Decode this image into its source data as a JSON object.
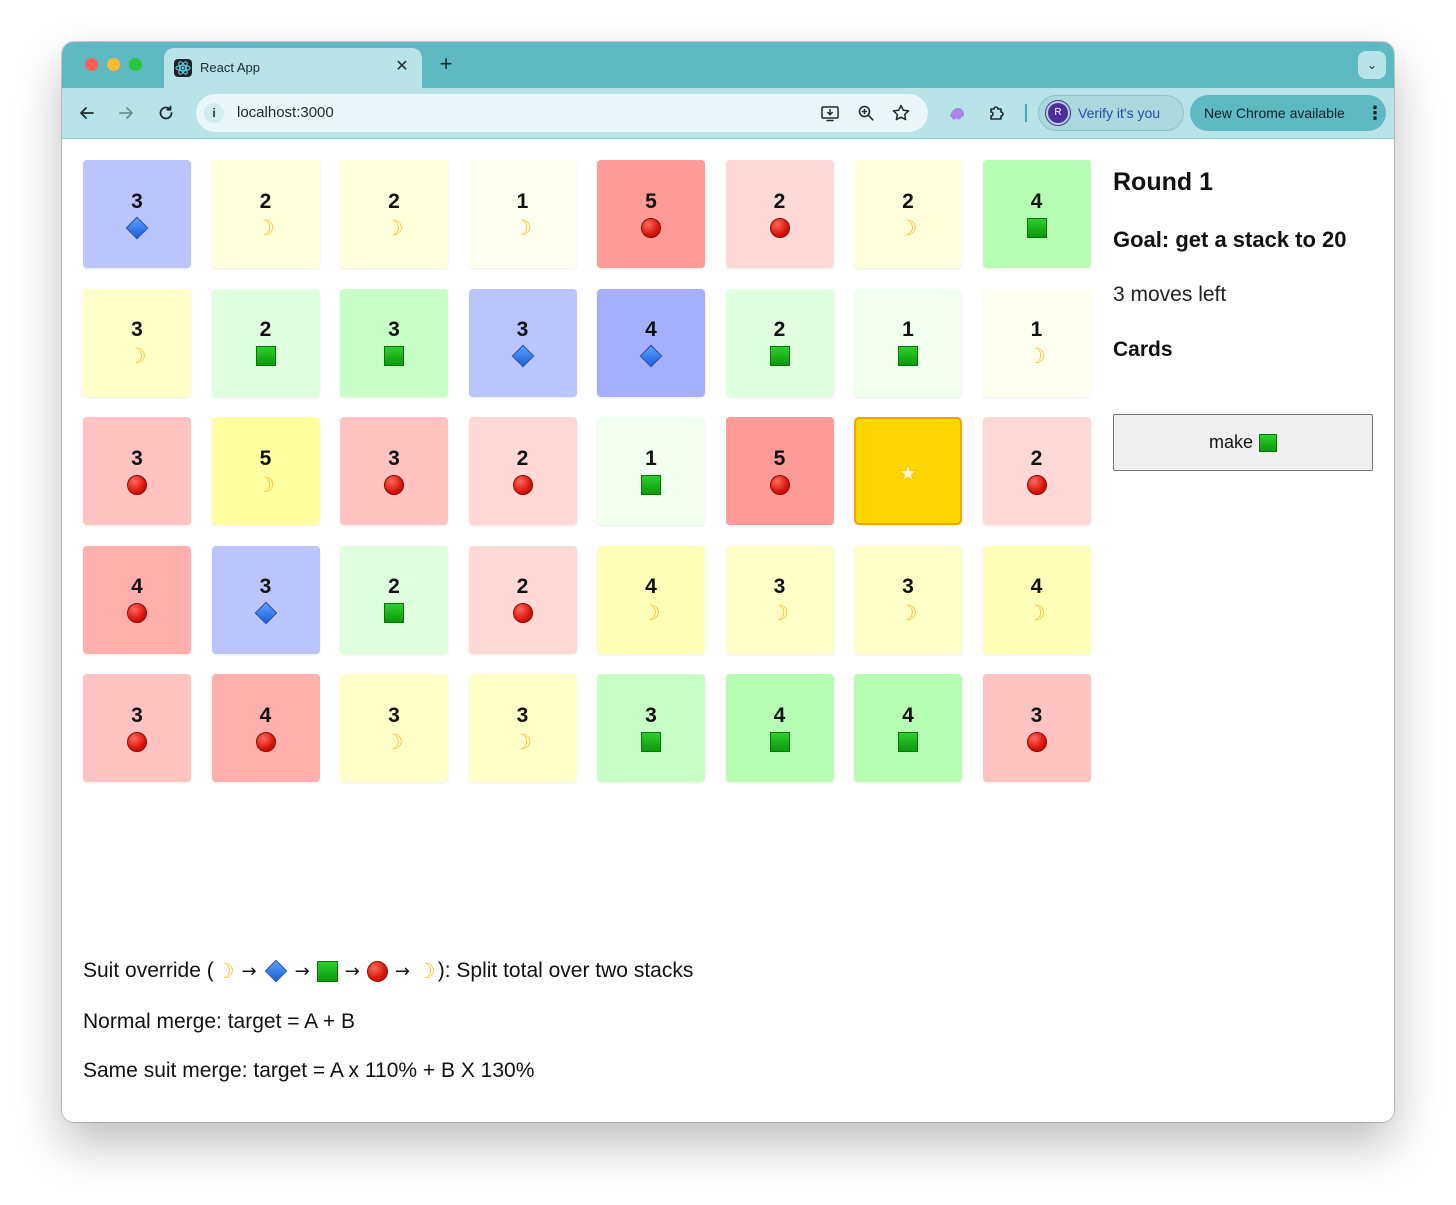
{
  "browser": {
    "tab_title": "React App",
    "tab_close_glyph": "✕",
    "new_tab_glyph": "+",
    "tab_search_glyph": "⌄",
    "url": "localhost:3000",
    "verify_label": "Verify it's you",
    "verify_avatar_letter": "R",
    "chrome_update_label": "New Chrome available",
    "icons": {
      "back": "back-arrow-icon",
      "forward": "forward-arrow-icon",
      "reload": "reload-icon",
      "site_info": "info-icon",
      "install": "install-app-icon",
      "zoom": "zoom-icon",
      "bookmark": "star-icon",
      "extension_ghost": "ghost-extension-icon",
      "extensions": "puzzle-icon",
      "menu": "kebab-menu-icon"
    },
    "colors": {
      "tab_strip": "#5fb9c2",
      "toolbar": "#b8e3e7",
      "omnibox": "#eaf6f7",
      "verify_text": "#1f4fa8"
    }
  },
  "game": {
    "round_label": "Round 1",
    "goal_label": "Goal: get a stack to 20",
    "moves_label": "3 moves left",
    "cards_label": "Cards",
    "make_button_label": "make",
    "make_button_suit": "square",
    "suit_legend": {
      "moon": "crescent-moon-icon",
      "diamond": "blue-diamond-icon",
      "square": "green-square-icon",
      "circle": "red-circle-icon",
      "star": "star-icon"
    },
    "suit_colors": {
      "diamond": "#1c5fd6",
      "circle": "#d9140a",
      "square": "#0a9a0a",
      "moon": "#f2c01e",
      "selected": "#ffd500"
    },
    "grid": [
      {
        "value": "3",
        "suit": "diamond",
        "color": "#bcc4fc"
      },
      {
        "value": "2",
        "suit": "moon",
        "color": "#ffffdc"
      },
      {
        "value": "2",
        "suit": "moon",
        "color": "#ffffdc"
      },
      {
        "value": "1",
        "suit": "moon",
        "color": "#fffff0"
      },
      {
        "value": "5",
        "suit": "circle",
        "color": "#fe9b96"
      },
      {
        "value": "2",
        "suit": "circle",
        "color": "#ffd8d8"
      },
      {
        "value": "2",
        "suit": "moon",
        "color": "#ffffdc"
      },
      {
        "value": "4",
        "suit": "square",
        "color": "#b6fdb3"
      },
      {
        "value": "3",
        "suit": "moon",
        "color": "#ffffc8"
      },
      {
        "value": "2",
        "suit": "square",
        "color": "#e0ffde"
      },
      {
        "value": "3",
        "suit": "square",
        "color": "#c8ffc6"
      },
      {
        "value": "3",
        "suit": "diamond",
        "color": "#bcc4fc"
      },
      {
        "value": "4",
        "suit": "diamond",
        "color": "#a5affb"
      },
      {
        "value": "2",
        "suit": "square",
        "color": "#e0ffde"
      },
      {
        "value": "1",
        "suit": "square",
        "color": "#f0fff0"
      },
      {
        "value": "1",
        "suit": "moon",
        "color": "#fffff0"
      },
      {
        "value": "3",
        "suit": "circle",
        "color": "#ffc4c2"
      },
      {
        "value": "5",
        "suit": "moon",
        "color": "#ffffa2"
      },
      {
        "value": "3",
        "suit": "circle",
        "color": "#ffc4c2"
      },
      {
        "value": "2",
        "suit": "circle",
        "color": "#ffd8d8"
      },
      {
        "value": "1",
        "suit": "square",
        "color": "#f0fff0"
      },
      {
        "value": "5",
        "suit": "circle",
        "color": "#fe9b96"
      },
      {
        "value": "",
        "suit": "star",
        "color": "#ffd500",
        "selected": true
      },
      {
        "value": "2",
        "suit": "circle",
        "color": "#ffd8d8"
      },
      {
        "value": "4",
        "suit": "circle",
        "color": "#ffb0ad"
      },
      {
        "value": "3",
        "suit": "diamond",
        "color": "#bcc4fc"
      },
      {
        "value": "2",
        "suit": "square",
        "color": "#e0ffde"
      },
      {
        "value": "2",
        "suit": "circle",
        "color": "#ffd8d8"
      },
      {
        "value": "4",
        "suit": "moon",
        "color": "#ffffb8"
      },
      {
        "value": "3",
        "suit": "moon",
        "color": "#ffffc8"
      },
      {
        "value": "3",
        "suit": "moon",
        "color": "#ffffc8"
      },
      {
        "value": "4",
        "suit": "moon",
        "color": "#ffffb8"
      },
      {
        "value": "3",
        "suit": "circle",
        "color": "#ffc4c2"
      },
      {
        "value": "4",
        "suit": "circle",
        "color": "#ffb0ad"
      },
      {
        "value": "3",
        "suit": "moon",
        "color": "#ffffc8"
      },
      {
        "value": "3",
        "suit": "moon",
        "color": "#ffffc8"
      },
      {
        "value": "3",
        "suit": "square",
        "color": "#c8ffc6"
      },
      {
        "value": "4",
        "suit": "square",
        "color": "#b6fdb3"
      },
      {
        "value": "4",
        "suit": "square",
        "color": "#b6fdb3"
      },
      {
        "value": "3",
        "suit": "circle",
        "color": "#ffc4c2"
      }
    ]
  },
  "rules": {
    "override_prefix": "Suit override (",
    "override_suffix": "): Split total over two stacks",
    "override_cycle": [
      "moon",
      "diamond",
      "square",
      "circle",
      "moon"
    ],
    "arrow_glyph": "→",
    "normal_merge": "Normal merge: target = A + B",
    "same_suit_merge": "Same suit merge: target = A x 110% + B X 130%"
  }
}
